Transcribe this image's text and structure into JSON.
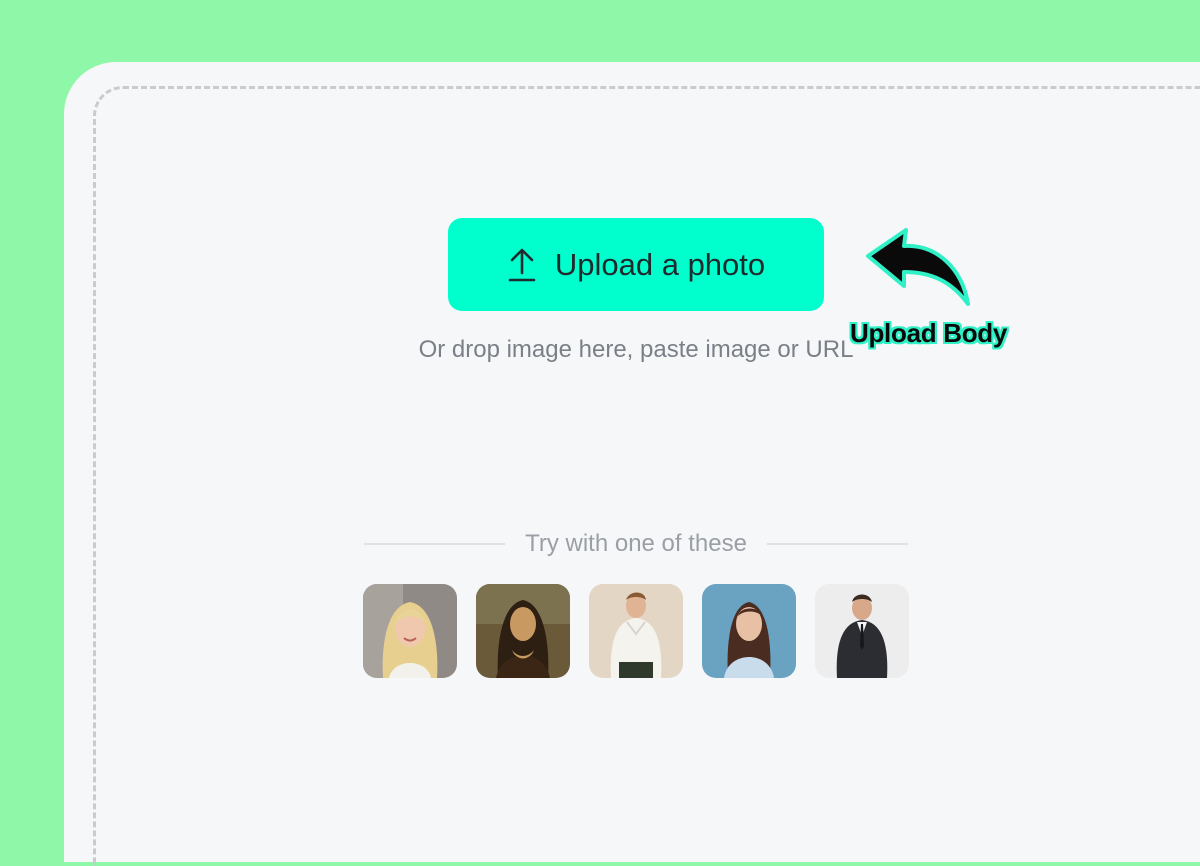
{
  "upload": {
    "button_label": "Upload a photo",
    "button_icon": "upload-arrow-icon",
    "hint": "Or drop image here, paste image or URL"
  },
  "annotation": {
    "label": "Upload Body",
    "icon": "curved-arrow-icon"
  },
  "samples": {
    "heading": "Try with one of these",
    "items": [
      {
        "name": "sample-blonde-woman"
      },
      {
        "name": "sample-classic-painting-woman"
      },
      {
        "name": "sample-man-white-hoodie"
      },
      {
        "name": "sample-woman-blue-background"
      },
      {
        "name": "sample-man-suit"
      }
    ]
  },
  "colors": {
    "background": "#8ef7a8",
    "card": "#f6f7f9",
    "accent": "#00ffcc",
    "annotation_outline": "#2ff0c6"
  }
}
